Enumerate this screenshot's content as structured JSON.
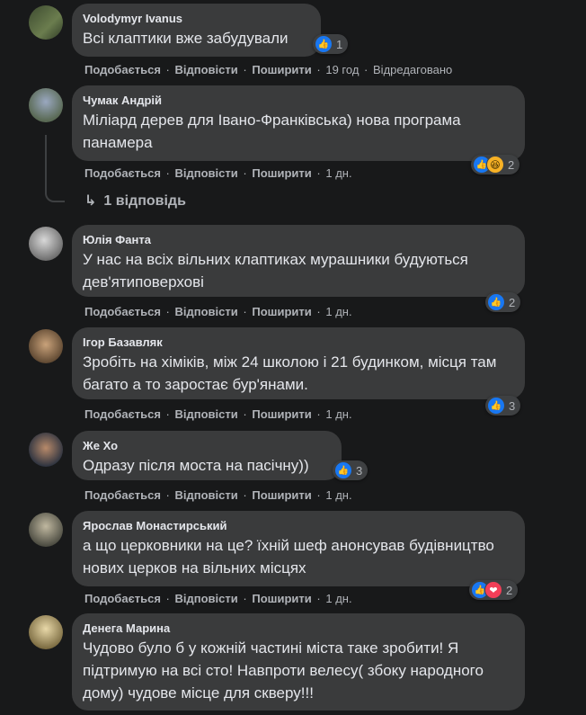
{
  "actions": {
    "like": "Подобається",
    "reply": "Відповісти",
    "share": "Поширити",
    "sep": "·"
  },
  "comments": [
    {
      "author": "Volodymyr Ivanus",
      "text": "Всі клаптики вже забудували",
      "time": "19 год",
      "edited": "Відредаговано",
      "reactions": [
        "like"
      ],
      "count": "1",
      "avatar_color": "#4a5a3a"
    },
    {
      "author": "Чумак Андрій",
      "text": "Міліард дерев для Івано-Франківська) нова програма панамера",
      "time": "1 дн.",
      "reactions": [
        "like",
        "haha"
      ],
      "count": "2",
      "avatar_color": "#7a8aa0"
    },
    {
      "author": "Юлія Фанта",
      "text": "У нас на всіх вільних клаптиках мурашники будуються дев'ятиповерхові",
      "time": "1 дн.",
      "reactions": [
        "like"
      ],
      "count": "2",
      "avatar_color": "#8a8a8a"
    },
    {
      "author": "Ігор Базавляк",
      "text": "Зробіть на хіміків, між 24 школою і 21 будинком, місця там багато а то заростає бур'янами.",
      "time": "1 дн.",
      "reactions": [
        "like"
      ],
      "count": "3",
      "avatar_color": "#8a7050"
    },
    {
      "author": "Же Хо",
      "text": "Одразу після моста на пасічну))",
      "time": "1 дн.",
      "reactions": [
        "like"
      ],
      "count": "3",
      "avatar_color": "#5a6070"
    },
    {
      "author": "Ярослав Монастирський",
      "text": "а що церковники на це? їхній шеф анонсував будівництво нових церков на вільних місцях",
      "time": "1 дн.",
      "reactions": [
        "like",
        "love"
      ],
      "count": "2",
      "avatar_color": "#6a6a5a"
    },
    {
      "author": "Денега Марина",
      "text": "Чудово було б у кожній частині міста таке зробити! Я підтримую на всі сто! Навпроти велесу( збоку народного дому) чудове місце для скверу!!!",
      "avatar_color": "#b0a070"
    }
  ],
  "thread": {
    "replies_label": "1 відповідь",
    "arrow_icon": "reply-arrow-icon"
  },
  "colors": {
    "background": "#18191a",
    "bubble": "#3a3b3c",
    "like_blue": "#1877f2",
    "love_red": "#f33e58",
    "haha_yellow": "#f7b125"
  }
}
